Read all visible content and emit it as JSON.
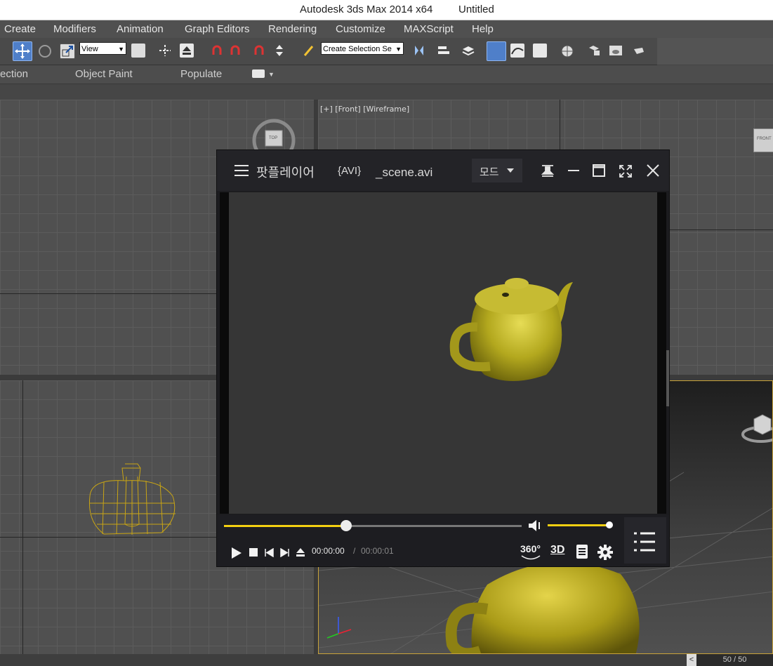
{
  "window": {
    "app_title": "Autodesk 3ds Max  2014 x64",
    "doc_title": "Untitled"
  },
  "menu": [
    "Create",
    "Modifiers",
    "Animation",
    "Graph Editors",
    "Rendering",
    "Customize",
    "MAXScript",
    "Help"
  ],
  "toolbar": {
    "reference_coord": "View",
    "named_selection_placeholder": "Create Selection Se"
  },
  "ribbon": {
    "tabs": [
      "ection",
      "Object Paint",
      "Populate"
    ]
  },
  "viewports": {
    "front_label": "[+] [Front] [Wireframe]",
    "top_viewcube": "TOP",
    "front_viewcube": "FRONT"
  },
  "player": {
    "app_name": "팟플레이어",
    "format": "{AVI}",
    "filename": "_scene.avi",
    "mode_label": "모드",
    "time_current": "00:00:00",
    "time_separator": "/",
    "time_total": "00:00:01",
    "progress_fraction": 0.41,
    "volume_fraction": 0.96,
    "btn_360": "360°",
    "btn_3d": "3D"
  },
  "timeline": {
    "frame_counter": "50 / 50"
  },
  "colors": {
    "accent": "#f3cf11",
    "teapot": "#b8a81e"
  }
}
